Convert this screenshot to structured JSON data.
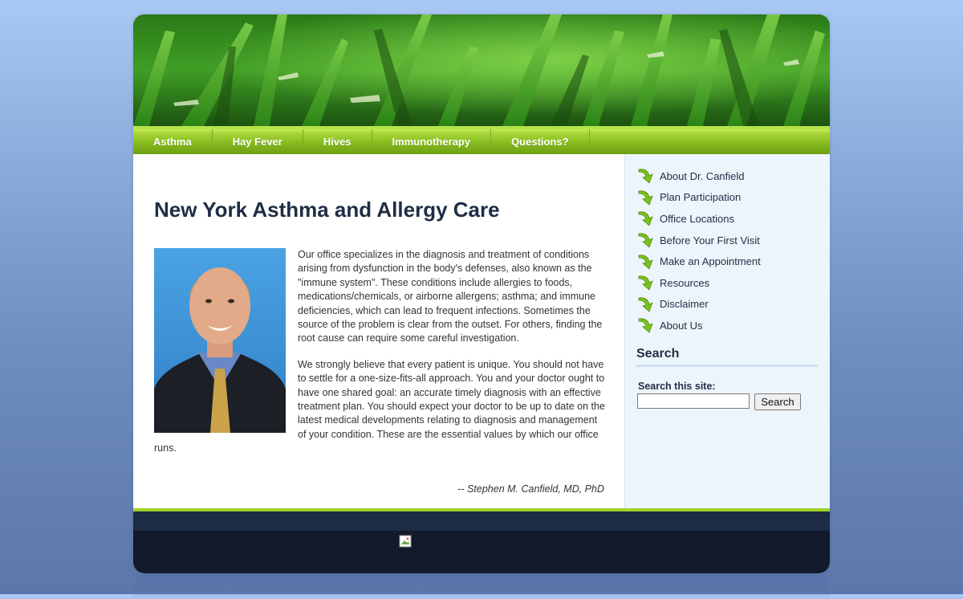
{
  "nav": {
    "items": [
      {
        "label": "Asthma"
      },
      {
        "label": "Hay Fever"
      },
      {
        "label": "Hives"
      },
      {
        "label": "Immunotherapy"
      },
      {
        "label": "Questions?"
      }
    ]
  },
  "main": {
    "title": "New York Asthma and Allergy Care",
    "paragraphs": [
      "Our office specializes in the diagnosis and treatment of conditions arising from dysfunction in the body's defenses, also known as the \"immune system\". These conditions include allergies to foods, medications/chemicals, or airborne allergens; asthma; and immune deficiencies, which can lead to frequent infections. Sometimes the source of the problem is clear from the outset. For others, finding the root cause can require some careful investigation.",
      "We strongly believe that every patient is unique. You should not have to settle for a one-size-fits-all approach. You and your doctor ought to have one shared goal: an accurate timely diagnosis with an effective treatment plan. You should expect your doctor to be up to date on the latest medical developments relating to diagnosis and management of your condition. These are the essential values by which our office runs."
    ],
    "signature": "-- Stephen M. Canfield, MD, PhD"
  },
  "sidebar": {
    "links": [
      {
        "label": "About Dr. Canfield"
      },
      {
        "label": "Plan Participation"
      },
      {
        "label": "Office Locations"
      },
      {
        "label": "Before Your First Visit"
      },
      {
        "label": "Make an Appointment"
      },
      {
        "label": "Resources"
      },
      {
        "label": "Disclaimer"
      },
      {
        "label": "About Us"
      }
    ],
    "search": {
      "heading": "Search",
      "label": "Search this site:",
      "value": "",
      "button": "Search"
    }
  },
  "colors": {
    "nav_green": "#86bb1f",
    "title_navy": "#1f2d45",
    "sidebar_bg": "#edf5fc",
    "footer_dark": "#121a2b",
    "accent_lime": "#9fd22a"
  }
}
